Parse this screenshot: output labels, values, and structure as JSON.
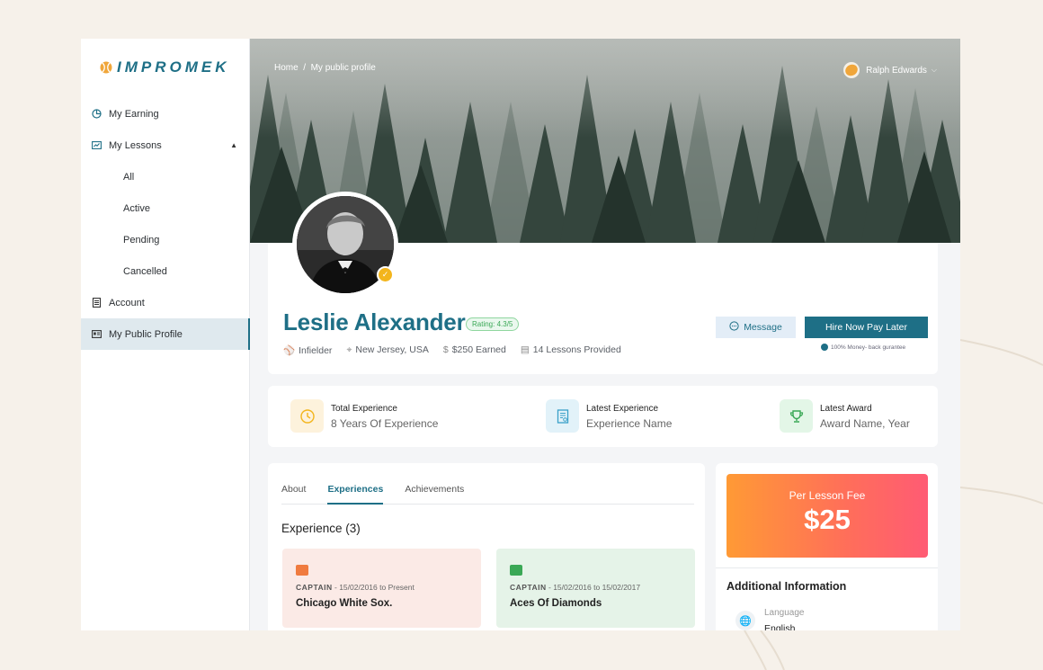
{
  "app": {
    "logo_text": "IMPROMEK"
  },
  "sidebar": {
    "items": [
      {
        "label": "My Earning",
        "icon": "pie-chart-icon"
      },
      {
        "label": "My Lessons",
        "icon": "chart-box-icon",
        "expanded": true
      },
      {
        "label": "All"
      },
      {
        "label": "Active"
      },
      {
        "label": "Pending"
      },
      {
        "label": "Cancelled"
      },
      {
        "label": "Account",
        "icon": "document-icon"
      },
      {
        "label": "My Public Profile",
        "icon": "id-card-icon",
        "active": true
      }
    ]
  },
  "header": {
    "breadcrumb_home": "Home",
    "breadcrumb_sep": "/",
    "breadcrumb_current": "My public profile",
    "user_name": "Ralph Edwards"
  },
  "profile": {
    "name": "Leslie Alexander",
    "rating": "Rating: 4.3/5",
    "position": "Infielder",
    "location": "New Jersey, USA",
    "earned": "$250 Earned",
    "lessons": "14 Lessons Provided",
    "message_label": "Message",
    "hire_label": "Hire Now Pay Later",
    "guarantee": "100% Money- back gurantee"
  },
  "stats": [
    {
      "label": "Total Experience",
      "value": "8 Years Of Experience",
      "color": "#f3b51c"
    },
    {
      "label": "Latest Experience",
      "value": "Experience Name",
      "color": "#3aa0c8"
    },
    {
      "label": "Latest Award",
      "value": "Award Name, Year",
      "color": "#3aa856"
    }
  ],
  "tabs": [
    "About",
    "Experiences",
    "Achievements"
  ],
  "active_tab": "Experiences",
  "experience": {
    "title": "Experience (3)",
    "items": [
      {
        "role": "CAPTAIN",
        "dates": " - 15/02/2016 to Present",
        "team": "Chicago White Sox.",
        "bg": "#fbeae6",
        "icon_color": "#f07b3f"
      },
      {
        "role": "CAPTAIN",
        "dates": " - 15/02/2016 to 15/02/2017",
        "team": "Aces Of Diamonds",
        "bg": "#e5f3e8",
        "icon_color": "#3aa856"
      }
    ]
  },
  "fee": {
    "label": "Per Lesson Fee",
    "value": "$25"
  },
  "additional": {
    "title": "Additional Information",
    "language_label": "Language",
    "language_value": "English"
  },
  "colors": {
    "accent": "#1e6f86",
    "background": "#f6f1ea"
  }
}
